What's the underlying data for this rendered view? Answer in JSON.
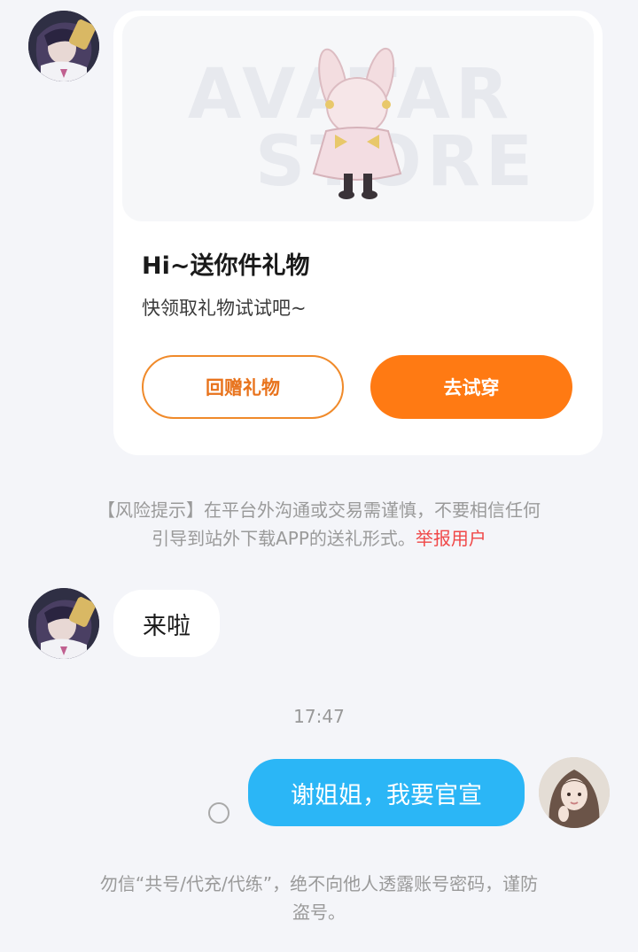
{
  "gift_card": {
    "watermark_line1": "AVATAR",
    "watermark_line2": "STORE",
    "title": "Hi~送你件礼物",
    "subtitle": "快领取礼物试试吧~",
    "return_gift_label": "回赠礼物",
    "try_on_label": "去试穿"
  },
  "risk_notice": {
    "line1": "【风险提示】在平台外沟通或交易需谨慎，不要相信任何",
    "line2": "引导到站外下载APP的送礼形式。",
    "report_link": "举报用户"
  },
  "messages": [
    {
      "sender": "other",
      "text": "来啦"
    },
    {
      "sender": "me",
      "text": "谢姐姐，我要官宣"
    }
  ],
  "timestamp": "17:47",
  "security_notice": {
    "line1": "勿信“共号/代充/代练”，绝不向他人透露账号密码，谨防",
    "line2": "盗号。"
  },
  "colors": {
    "accent_orange": "#ff7a13",
    "bubble_blue": "#2bb6f6",
    "report_red": "#f04848"
  }
}
